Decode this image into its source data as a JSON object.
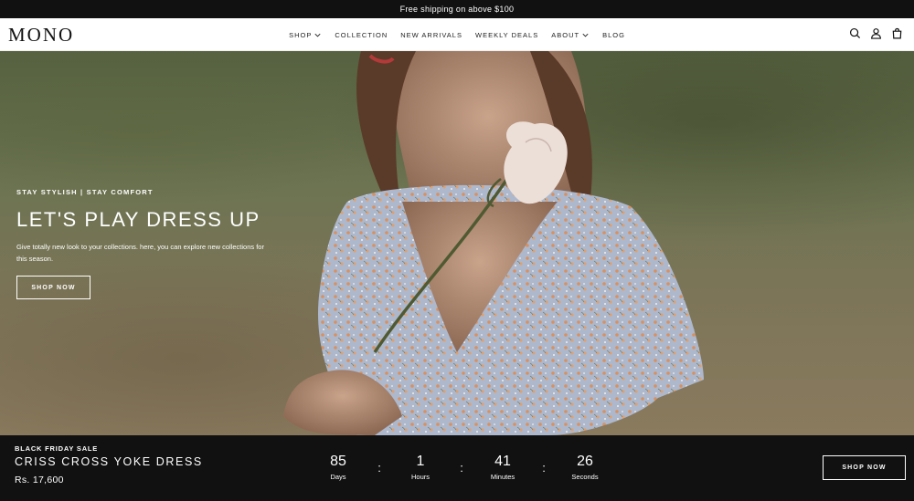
{
  "announcement": "Free shipping on above $100",
  "brand": "MONO",
  "nav": [
    {
      "label": "SHOP",
      "dropdown": true
    },
    {
      "label": "COLLECTION",
      "dropdown": false
    },
    {
      "label": "NEW ARRIVALS",
      "dropdown": false
    },
    {
      "label": "WEEKLY DEALS",
      "dropdown": false
    },
    {
      "label": "ABOUT",
      "dropdown": true
    },
    {
      "label": "BLOG",
      "dropdown": false
    }
  ],
  "header_icons": [
    "search-icon",
    "account-icon",
    "cart-icon"
  ],
  "hero": {
    "eyebrow": "STAY STYLISH | STAY COMFORT",
    "title": "LET'S PLAY DRESS UP",
    "description": "Give totally new look to your collections. here, you can explore new collections for this season.",
    "button": "SHOP NOW"
  },
  "promo": {
    "eyebrow": "BLACK FRIDAY SALE",
    "title": "CRISS CROSS YOKE DRESS",
    "price": "Rs. 17,600",
    "countdown": [
      {
        "value": "85",
        "label": "Days"
      },
      {
        "value": "1",
        "label": "Hours"
      },
      {
        "value": "41",
        "label": "Minutes"
      },
      {
        "value": "26",
        "label": "Seconds"
      }
    ],
    "separator": ":",
    "button": "SHOP NOW"
  },
  "colors": {
    "bar_bg": "#111111",
    "text_light": "#ffffff"
  }
}
